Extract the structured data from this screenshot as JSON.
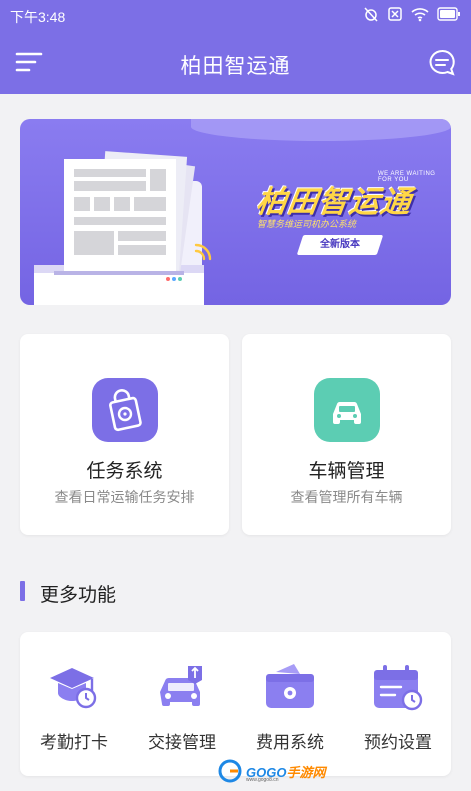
{
  "status_bar": {
    "time": "下午3:48",
    "icons": [
      "alarm-off-icon",
      "sim-off-icon",
      "wifi-icon",
      "battery-icon"
    ]
  },
  "app_bar": {
    "title": "柏田智运通",
    "menu_icon": "menu-icon",
    "message_icon": "message-icon"
  },
  "banner": {
    "tagline_top": "WE ARE WAITING FOR YOU",
    "brand": "柏田智运通",
    "subtitle": "智慧务维运司机办公系统",
    "badge": "全新版本"
  },
  "cards": [
    {
      "title": "任务系统",
      "subtitle": "查看日常运输任务安排",
      "icon": "task-bag-icon",
      "color": "#7c6fe6"
    },
    {
      "title": "车辆管理",
      "subtitle": "查看管理所有车辆",
      "icon": "car-icon",
      "color": "#5ccdb3"
    }
  ],
  "section": {
    "title": "更多功能"
  },
  "more_items": [
    {
      "label": "考勤打卡",
      "icon": "attendance-icon"
    },
    {
      "label": "交接管理",
      "icon": "handover-icon"
    },
    {
      "label": "费用系统",
      "icon": "wallet-icon"
    },
    {
      "label": "预约设置",
      "icon": "calendar-icon"
    }
  ],
  "watermark": {
    "brand_a": "GOGO",
    "brand_b": "手游网",
    "url": "www.gogo8.cn"
  },
  "colors": {
    "primary": "#7c6fe6",
    "teal": "#5ccdb3",
    "background": "#f2f2f4"
  }
}
